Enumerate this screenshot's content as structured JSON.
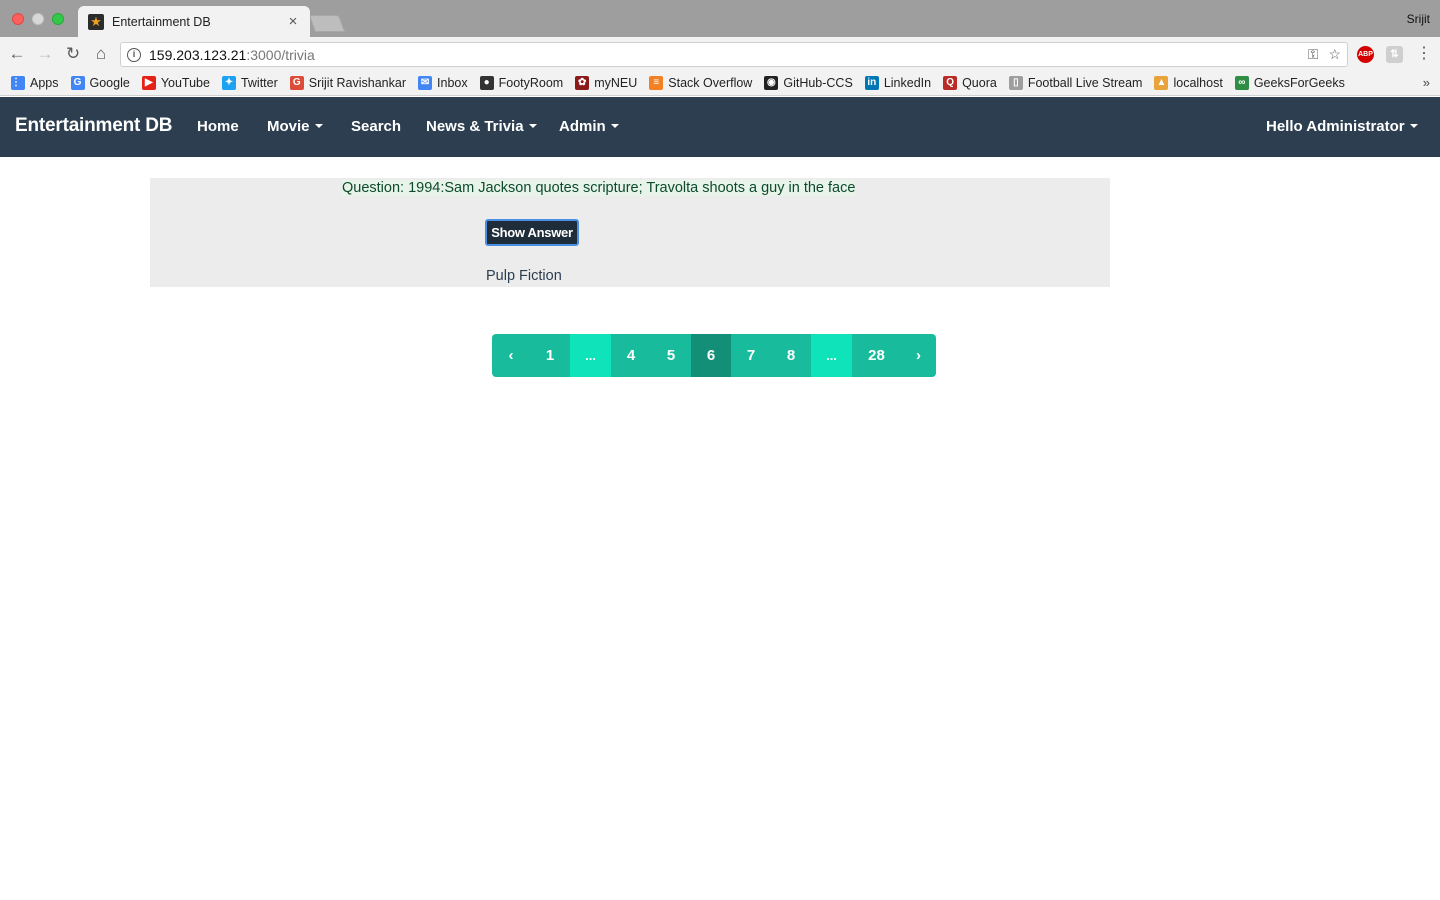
{
  "browser": {
    "tab_title": "Entertainment DB",
    "tab_close": "×",
    "profile": "Srijit",
    "url_host": "159.203.123.21",
    "url_path": ":3000/trivia",
    "bookmarks": [
      {
        "label": "Apps",
        "icon": "apps-grid-icon",
        "color": "#4285f4"
      },
      {
        "label": "Google",
        "icon": "google-icon",
        "color": "#4285f4"
      },
      {
        "label": "YouTube",
        "icon": "youtube-icon",
        "color": "#e62117"
      },
      {
        "label": "Twitter",
        "icon": "twitter-icon",
        "color": "#1da1f2"
      },
      {
        "label": "Srijit Ravishankar",
        "icon": "google-plus-icon",
        "color": "#dd4b39"
      },
      {
        "label": "Inbox",
        "icon": "inbox-icon",
        "color": "#4285f4"
      },
      {
        "label": "FootyRoom",
        "icon": "footyroom-icon",
        "color": "#333333"
      },
      {
        "label": "myNEU",
        "icon": "paw-icon",
        "color": "#8b1a1a"
      },
      {
        "label": "Stack Overflow",
        "icon": "stackoverflow-icon",
        "color": "#f48024"
      },
      {
        "label": "GitHub-CCS",
        "icon": "github-icon",
        "color": "#222222"
      },
      {
        "label": "LinkedIn",
        "icon": "linkedin-icon",
        "color": "#0077b5"
      },
      {
        "label": "Quora",
        "icon": "quora-icon",
        "color": "#b92b27"
      },
      {
        "label": "Football Live Stream",
        "icon": "page-icon",
        "color": "#9e9e9e"
      },
      {
        "label": "localhost",
        "icon": "localhost-icon",
        "color": "#e8a33c"
      },
      {
        "label": "GeeksForGeeks",
        "icon": "geeksforgeeks-icon",
        "color": "#2f8d46"
      }
    ],
    "bookmarks_more": "»"
  },
  "navbar": {
    "brand": "Entertainment DB",
    "home": "Home",
    "movie": "Movie",
    "search": "Search",
    "news_trivia": "News & Trivia",
    "admin": "Admin",
    "user": "Hello Administrator"
  },
  "trivia": {
    "question": "Question: 1994:Sam Jackson quotes scripture; Travolta shoots a guy in the face",
    "show_answer_label": "Show Answer",
    "answer": "Pulp Fiction"
  },
  "pagination": {
    "prev": "‹",
    "next": "›",
    "pages": [
      {
        "label": "1",
        "state": "normal"
      },
      {
        "label": "...",
        "state": "ellipsis"
      },
      {
        "label": "4",
        "state": "normal"
      },
      {
        "label": "5",
        "state": "normal"
      },
      {
        "label": "6",
        "state": "active"
      },
      {
        "label": "7",
        "state": "normal"
      },
      {
        "label": "8",
        "state": "normal"
      },
      {
        "label": "...",
        "state": "ellipsis"
      },
      {
        "label": "28",
        "state": "normal"
      }
    ]
  },
  "colors": {
    "navbar": "#2c3e50",
    "page": "#18bc9c",
    "page_active": "#128f76",
    "page_ellipsis": "#0fe3b9"
  }
}
